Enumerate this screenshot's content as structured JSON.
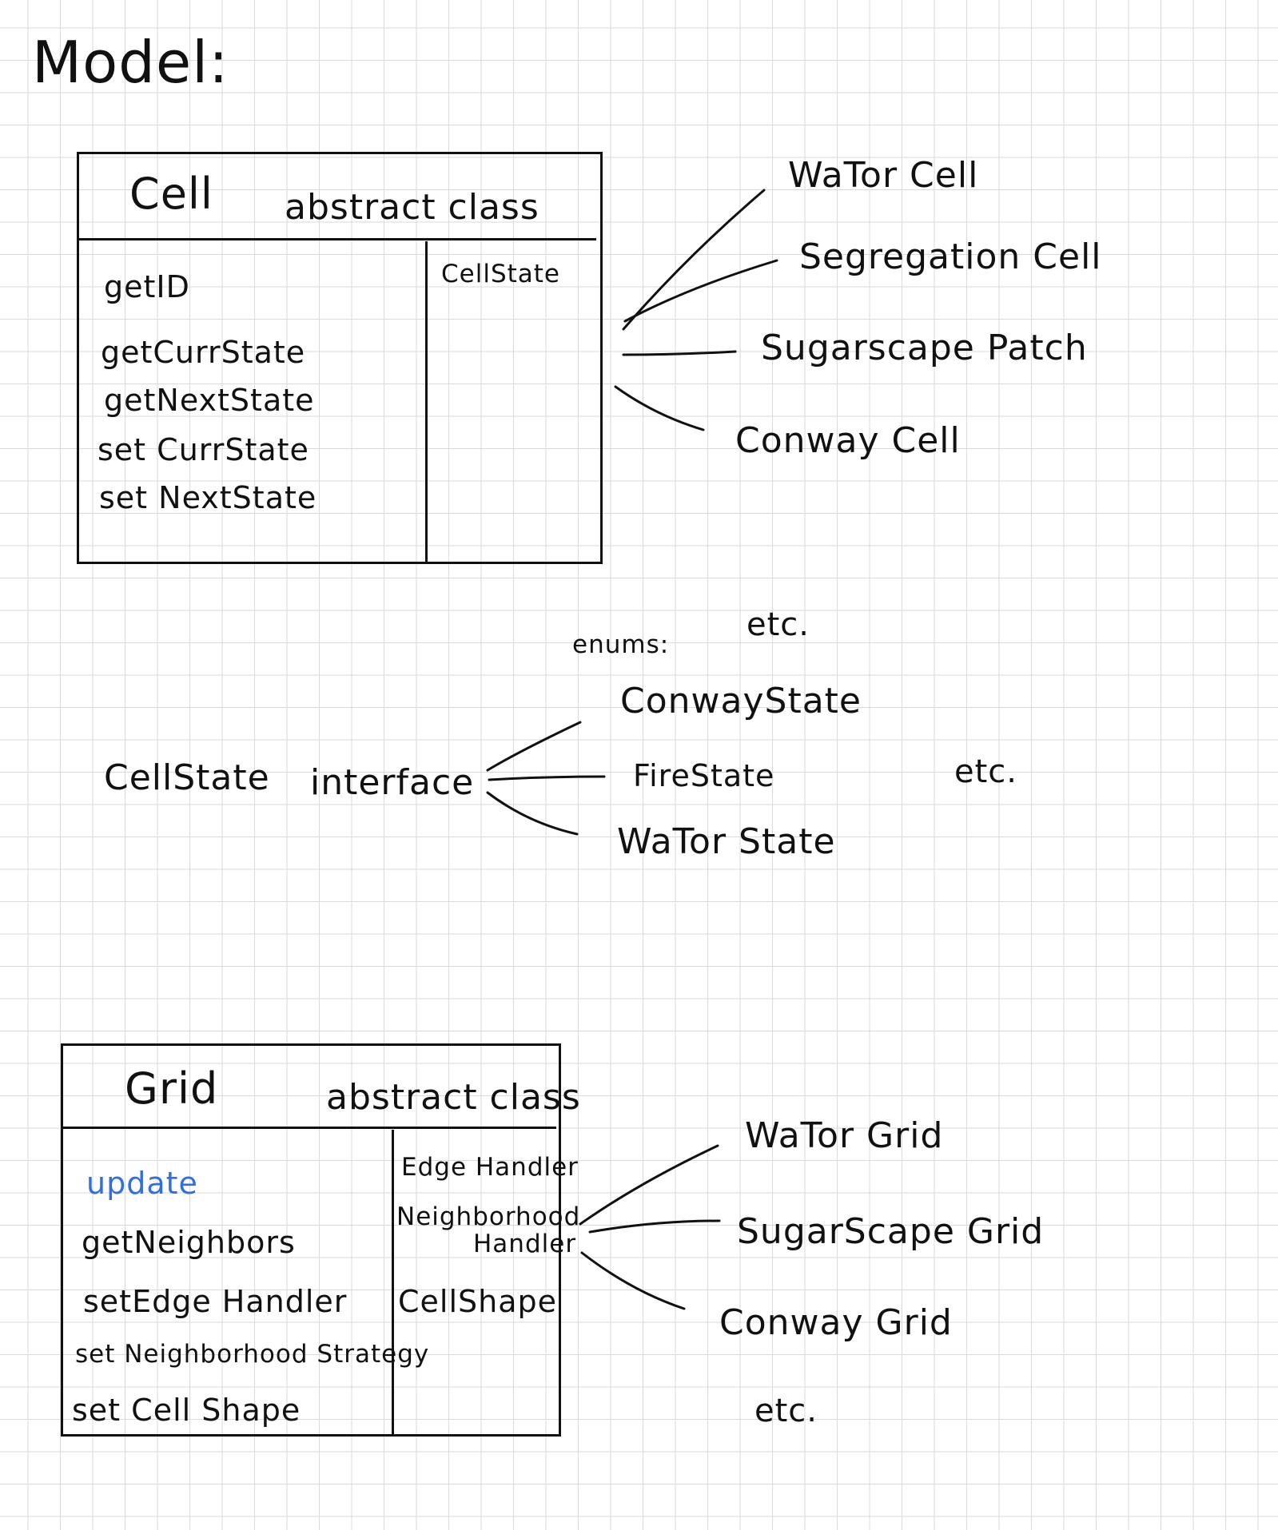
{
  "title": "Model:",
  "cell_class": {
    "name": "Cell",
    "kind": "abstract class",
    "methods": [
      "getID",
      "getCurrState",
      "getNextState",
      "set CurrState",
      "set NextState"
    ],
    "fields": [
      "CellState"
    ]
  },
  "cell_subclasses": [
    "WaTor Cell",
    "Segregation Cell",
    "Sugarscape Patch",
    "Conway Cell"
  ],
  "cell_etc": "etc.",
  "cellstate": {
    "name": "CellState",
    "kind": "interface",
    "enums_label": "enums:",
    "enums": [
      "ConwayState",
      "FireState",
      "WaTor State"
    ],
    "etc": "etc."
  },
  "grid_class": {
    "name": "Grid",
    "kind": "abstract class",
    "methods": [
      "update",
      "getNeighbors",
      "setEdge Handler",
      "set Neighborhood Strategy",
      "set Cell Shape"
    ],
    "fields": [
      "Edge Handler",
      "Neighborhood",
      "Handler",
      "CellShape"
    ]
  },
  "grid_subclasses": [
    "WaTor Grid",
    "SugarScape Grid",
    "Conway Grid"
  ],
  "grid_etc": "etc.",
  "colors": {
    "ink": "#111111",
    "highlight": "#2f6fe0",
    "grid_line": "#dadada"
  }
}
